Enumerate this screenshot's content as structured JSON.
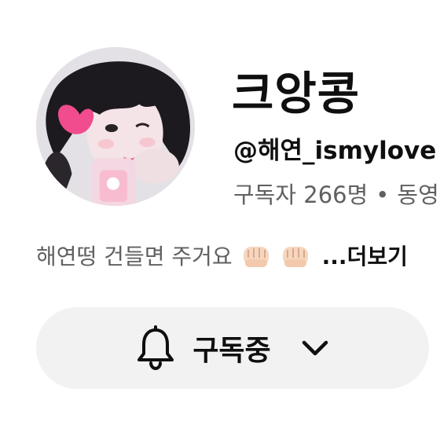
{
  "channel": {
    "name": "크앙콩",
    "handle": "@해연_ismylove",
    "subscribers": "구독자 266명",
    "separator": "•",
    "videos_partial": "동영"
  },
  "bio": {
    "text": "해연떵 건들면 주거요",
    "emoji_icons": [
      "fist-emoji-icon",
      "fist-emoji-icon"
    ],
    "more_label": "...더보기"
  },
  "subscribe_button": {
    "label": "구독중",
    "icons": [
      "bell-icon",
      "chevron-down-icon"
    ]
  },
  "colors": {
    "primary_text": "#0f0f0f",
    "secondary_text": "#606060",
    "button_bg": "#f2f2f2"
  }
}
